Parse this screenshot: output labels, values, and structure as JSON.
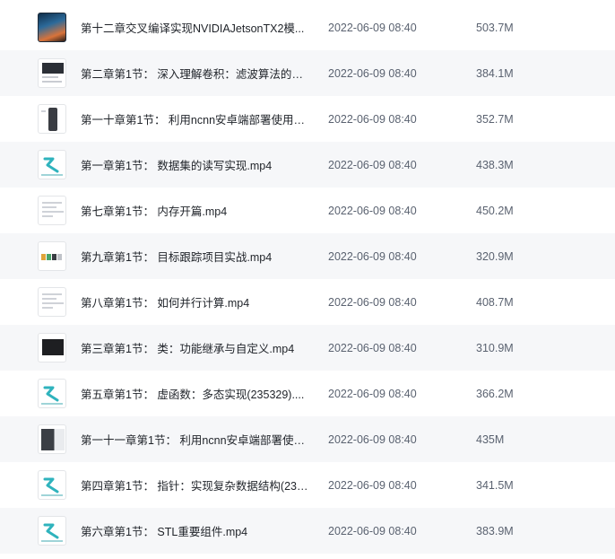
{
  "files": [
    {
      "name": "第十二章交叉编译实现NVIDIAJetsonTX2模...",
      "date": "2022-06-09 08:40",
      "size": "503.7M",
      "thumb": "nvidia-image-icon"
    },
    {
      "name": "第二章第1节： 深入理解卷积：滤波算法的底...",
      "date": "2022-06-09 08:40",
      "size": "384.1M",
      "thumb": "video-icon"
    },
    {
      "name": "第一十章第1节： 利用ncnn安卓端部署使用人...",
      "date": "2022-06-09 08:40",
      "size": "352.7M",
      "thumb": "video-icon"
    },
    {
      "name": "第一章第1节： 数据集的读写实现.mp4",
      "date": "2022-06-09 08:40",
      "size": "438.3M",
      "thumb": "video-icon"
    },
    {
      "name": "第七章第1节： 内存开篇.mp4",
      "date": "2022-06-09 08:40",
      "size": "450.2M",
      "thumb": "video-icon"
    },
    {
      "name": "第九章第1节： 目标跟踪项目实战.mp4",
      "date": "2022-06-09 08:40",
      "size": "320.9M",
      "thumb": "video-icon"
    },
    {
      "name": "第八章第1节： 如何并行计算.mp4",
      "date": "2022-06-09 08:40",
      "size": "408.7M",
      "thumb": "video-icon"
    },
    {
      "name": "第三章第1节： 类：功能继承与自定义.mp4",
      "date": "2022-06-09 08:40",
      "size": "310.9M",
      "thumb": "video-icon"
    },
    {
      "name": "第五章第1节： 虚函数：多态实现(235329)....",
      "date": "2022-06-09 08:40",
      "size": "366.2M",
      "thumb": "video-icon"
    },
    {
      "name": "第一十一章第1节： 利用ncnn安卓端部署使用...",
      "date": "2022-06-09 08:40",
      "size": "435M",
      "thumb": "video-icon"
    },
    {
      "name": "第四章第1节： 指针：实现复杂数据结构(235...",
      "date": "2022-06-09 08:40",
      "size": "341.5M",
      "thumb": "video-icon"
    },
    {
      "name": "第六章第1节： STL重要组件.mp4",
      "date": "2022-06-09 08:40",
      "size": "383.9M",
      "thumb": "video-icon"
    }
  ]
}
